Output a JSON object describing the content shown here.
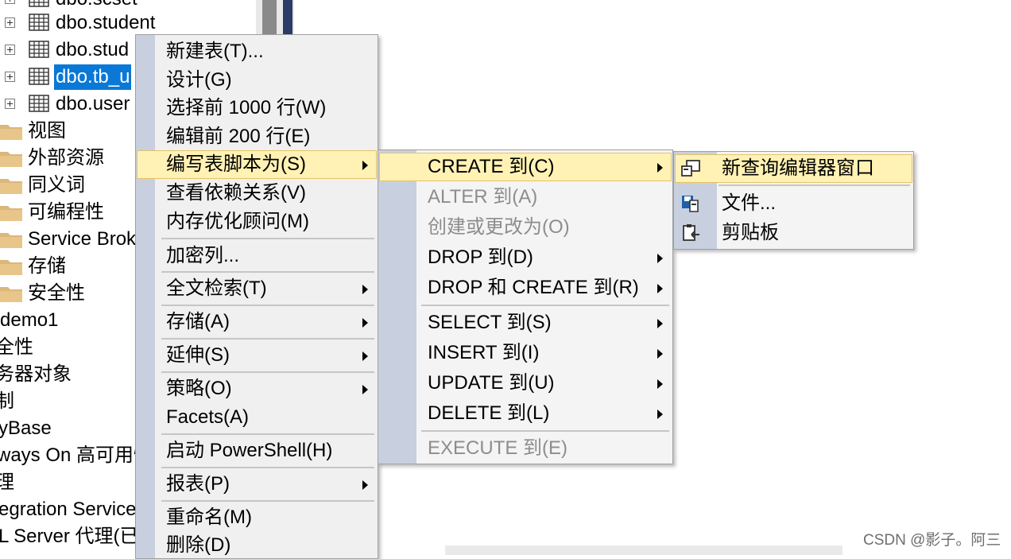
{
  "tree": {
    "items": [
      {
        "label": "dbo.scset",
        "kind": "table"
      },
      {
        "label": "dbo.student",
        "kind": "table"
      },
      {
        "label": "dbo.stud",
        "kind": "table"
      },
      {
        "label": "dbo.tb_u",
        "kind": "table",
        "selected": true
      },
      {
        "label": "dbo.user",
        "kind": "table"
      },
      {
        "label": "视图",
        "kind": "folder"
      },
      {
        "label": "外部资源",
        "kind": "folder"
      },
      {
        "label": "同义词",
        "kind": "folder"
      },
      {
        "label": "可编程性",
        "kind": "folder"
      },
      {
        "label": "Service Brok",
        "kind": "folder"
      },
      {
        "label": "存储",
        "kind": "folder"
      },
      {
        "label": "安全性",
        "kind": "folder"
      },
      {
        "label": "demo1",
        "kind": "text"
      },
      {
        "label": "全性",
        "kind": "text"
      },
      {
        "label": "务器对象",
        "kind": "text"
      },
      {
        "label": "制",
        "kind": "text"
      },
      {
        "label": "yBase",
        "kind": "text"
      },
      {
        "label": "ways On 高可用性",
        "kind": "text"
      },
      {
        "label": "理",
        "kind": "text"
      },
      {
        "label": "egration Service",
        "kind": "text"
      },
      {
        "label": "L Server 代理(已",
        "kind": "text"
      }
    ]
  },
  "context_menu": {
    "items": [
      {
        "label": "新建表(T)..."
      },
      {
        "label": "设计(G)"
      },
      {
        "label": "选择前 1000 行(W)"
      },
      {
        "label": "编辑前 200 行(E)"
      },
      {
        "label": "编写表脚本为(S)",
        "submenu": true,
        "highlighted": true
      },
      {
        "label": "查看依赖关系(V)"
      },
      {
        "label": "内存优化顾问(M)"
      },
      {
        "label": "加密列..."
      },
      {
        "label": "全文检索(T)",
        "submenu": true
      },
      {
        "label": "存储(A)",
        "submenu": true
      },
      {
        "label": "延伸(S)",
        "submenu": true
      },
      {
        "label": "策略(O)",
        "submenu": true
      },
      {
        "label": "Facets(A)"
      },
      {
        "label": "启动 PowerShell(H)"
      },
      {
        "label": "报表(P)",
        "submenu": true
      },
      {
        "label": "重命名(M)"
      },
      {
        "label": "删除(D)"
      }
    ]
  },
  "script_menu": {
    "items": [
      {
        "label": "CREATE 到(C)",
        "submenu": true,
        "highlighted": true
      },
      {
        "label": "ALTER 到(A)",
        "disabled": true
      },
      {
        "label": "创建或更改为(O)",
        "disabled": true
      },
      {
        "label": "DROP 到(D)",
        "submenu": true
      },
      {
        "label": "DROP 和 CREATE 到(R)",
        "submenu": true
      },
      {
        "label": "SELECT 到(S)",
        "submenu": true
      },
      {
        "label": "INSERT 到(I)",
        "submenu": true
      },
      {
        "label": "UPDATE 到(U)",
        "submenu": true
      },
      {
        "label": "DELETE 到(L)",
        "submenu": true
      },
      {
        "label": "EXECUTE 到(E)",
        "disabled": true
      }
    ]
  },
  "create_menu": {
    "items": [
      {
        "label": "新查询编辑器窗口",
        "icon": "new-query-window-icon",
        "highlighted": true
      },
      {
        "label": "文件...",
        "icon": "save-file-icon"
      },
      {
        "label": "剪贴板",
        "icon": "clipboard-icon"
      }
    ]
  },
  "watermark": "CSDN @影子。阿三",
  "colors": {
    "selection": "#0a78d7",
    "menu_highlight": "#fff2b4",
    "menu_bg": "#f0f0f0",
    "gutter": "#c8d0e0"
  }
}
